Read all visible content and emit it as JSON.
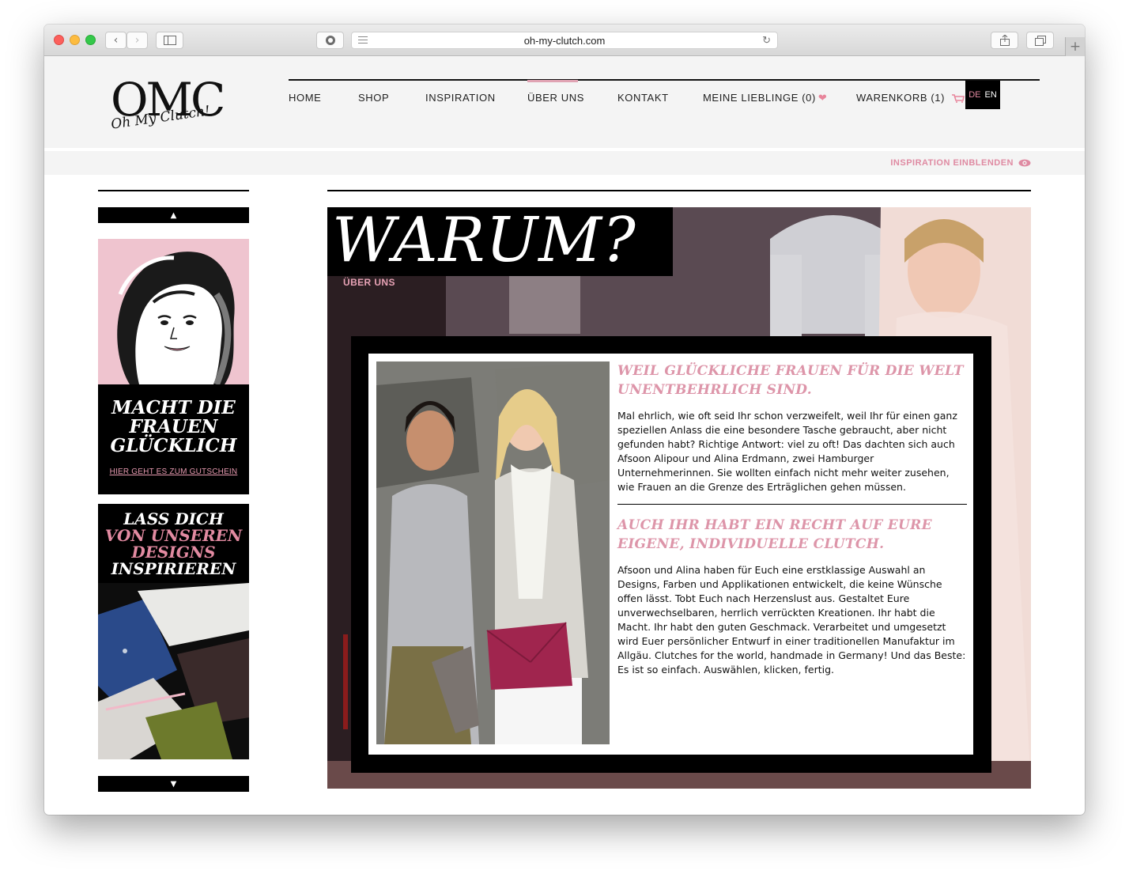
{
  "browser": {
    "url": "oh-my-clutch.com"
  },
  "site": {
    "logo": {
      "main": "OMC",
      "script": "Oh My Clutch!"
    },
    "nav": {
      "home": "HOME",
      "shop": "SHOP",
      "inspiration": "INSPIRATION",
      "about": "ÜBER UNS",
      "contact": "KONTAKT",
      "favorites": "MEINE LIEBLINGE (0)",
      "cart": "WARENKORB (1)"
    },
    "lang": {
      "de": "DE",
      "en": "EN"
    },
    "inspire_toggle": "INSPIRATION EINBLENDEN"
  },
  "sidebar": {
    "promo1": {
      "headline": "MACHT DIE\nFRAUEN\nGLÜCKLICH",
      "link": "HIER GEHT ES ZUM GUTSCHEIN"
    },
    "promo2": {
      "line1": "LASS DICH",
      "line2": "VON UNSEREN",
      "line3": "DESIGNS",
      "line4": "INSPIRIEREN"
    }
  },
  "hero": {
    "title": "WARUM?",
    "subtitle": "ÜBER UNS"
  },
  "article": {
    "heading1": "WEIL GLÜCKLICHE FRAUEN FÜR DIE WELT UNENTBEHRLICH SIND.",
    "para1": "Mal ehrlich, wie oft seid Ihr schon verzweifelt, weil Ihr für einen ganz speziellen Anlass die eine besondere Tasche gebraucht, aber nicht gefunden habt? Richtige Antwort: viel zu oft! Das dachten sich auch Afsoon Alipour und Alina Erdmann, zwei Hamburger Unternehmerinnen. Sie wollten einfach nicht mehr weiter zusehen, wie Frauen an die Grenze des Erträglichen gehen müssen.",
    "heading2": "AUCH IHR HABT EIN RECHT AUF EURE EIGENE, INDIVIDUELLE CLUTCH.",
    "para2": "Afsoon und Alina haben für Euch eine erstklassige Auswahl an Designs, Farben und Applikationen entwickelt, die keine Wünsche offen lässt. Tobt Euch nach Herzenslust aus. Gestaltet Eure unverwechselbaren, herrlich verrückten Kreationen. Ihr habt die Macht. Ihr habt den guten Geschmack. Verarbeitet und umgesetzt wird Euer persönlicher Entwurf in einer traditionellen Manufaktur im Allgäu. Clutches for the world, handmade in Germany! Und das Beste: Es ist so einfach. Auswählen, klicken, fertig."
  },
  "colors": {
    "accent_pink": "#df8aa2",
    "heading_pink": "#dd95a9",
    "black": "#000000",
    "header_bg": "#f4f4f4"
  }
}
